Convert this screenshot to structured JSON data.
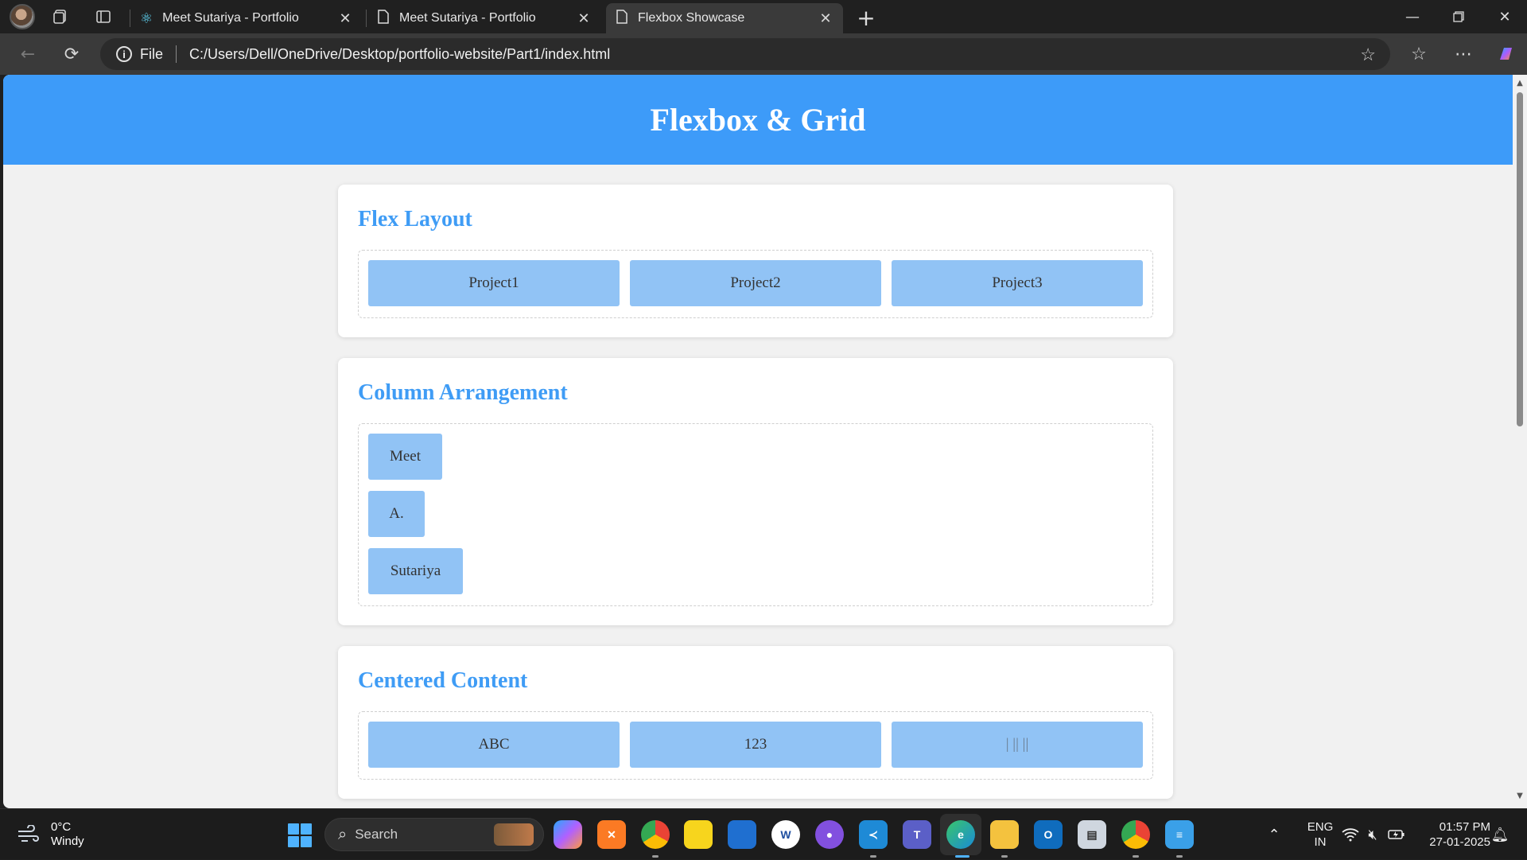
{
  "browser": {
    "tabs": [
      {
        "title": "Meet Sutariya - Portfolio",
        "icon": "react-icon",
        "active": false
      },
      {
        "title": "Meet Sutariya - Portfolio",
        "icon": "document-icon",
        "active": false
      },
      {
        "title": "Flexbox Showcase",
        "icon": "document-icon",
        "active": true
      }
    ],
    "close_glyph": "✕",
    "address": {
      "scheme_label": "File",
      "url": "C:/Users/Dell/OneDrive/Desktop/portfolio-website/Part1/index.html"
    }
  },
  "page": {
    "header_title": "Flexbox & Grid",
    "sections": [
      {
        "title": "Flex Layout",
        "items": [
          "Project1",
          "Project2",
          "Project3"
        ]
      },
      {
        "title": "Column Arrangement",
        "items": [
          "Meet",
          "A.",
          "Sutariya"
        ]
      },
      {
        "title": "Centered Content",
        "items": [
          "ABC",
          "123",
          "| || ||"
        ]
      }
    ],
    "colors": {
      "header": "#3d9bf9",
      "heading": "#3f9cf5",
      "box": "#91c3f5"
    }
  },
  "taskbar": {
    "weather": {
      "temp": "0°C",
      "condition": "Windy"
    },
    "search_placeholder": "Search",
    "apps": [
      "copilot-icon",
      "xampp-icon",
      "chrome-icon",
      "sticky-notes-icon",
      "store-icon",
      "word-icon",
      "github-icon",
      "vscode-icon",
      "teams-icon",
      "edge-icon",
      "file-explorer-icon",
      "outlook-icon",
      "db-tool-icon",
      "chrome-profile-icon",
      "notepad-icon"
    ],
    "tray": {
      "lang_top": "ENG",
      "lang_bottom": "IN",
      "time": "01:57 PM",
      "date": "27-01-2025"
    }
  }
}
